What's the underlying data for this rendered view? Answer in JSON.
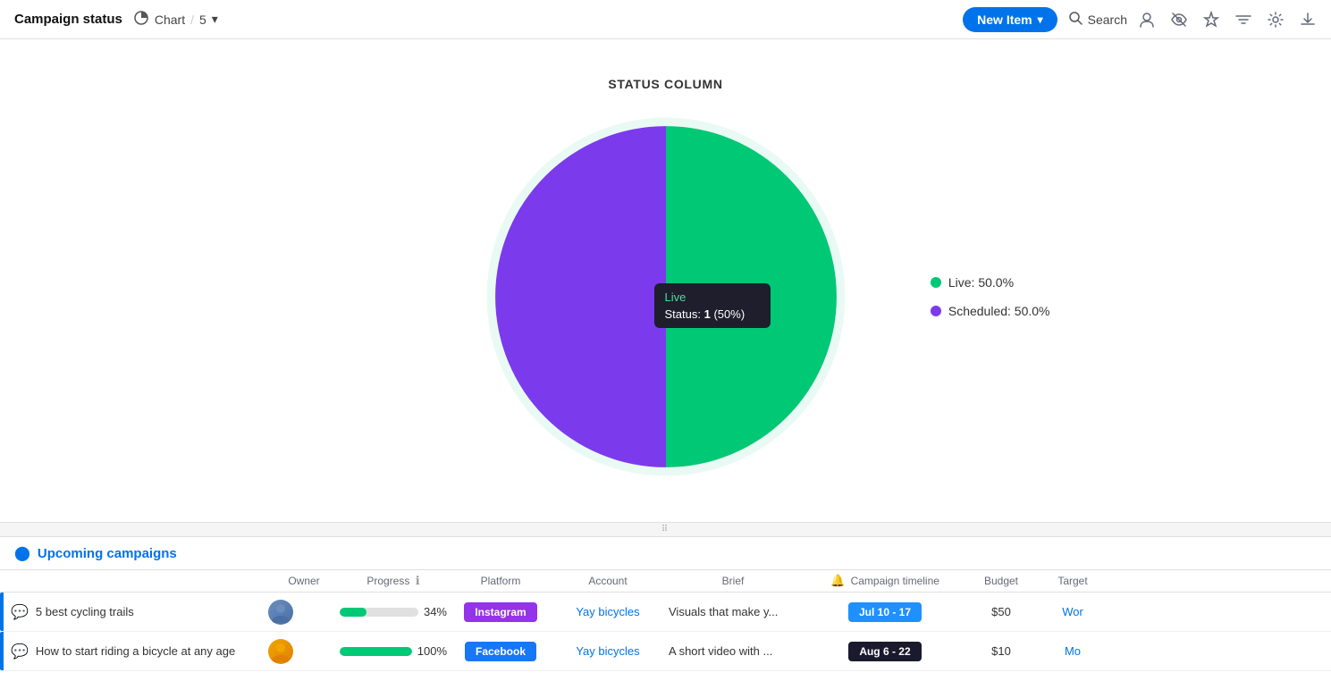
{
  "header": {
    "title": "Campaign status",
    "view_label": "Chart",
    "view_count": "5",
    "new_item_label": "New Item",
    "search_label": "Search"
  },
  "chart": {
    "title": "STATUS COLUMN",
    "legend": [
      {
        "label": "Live: 50.0%",
        "color": "#00c875"
      },
      {
        "label": "Scheduled: 50.0%",
        "color": "#7c3aed"
      }
    ],
    "tooltip": {
      "segment_label": "Live",
      "value_label": "Status:",
      "value": "1",
      "percent": "50%"
    },
    "segments": [
      {
        "label": "Live",
        "percent": 50,
        "color": "#00c875"
      },
      {
        "label": "Scheduled",
        "percent": 50,
        "color": "#7c3aed"
      }
    ]
  },
  "table": {
    "section_title": "Upcoming campaigns",
    "columns": [
      "Owner",
      "Progress",
      "Platform",
      "Account",
      "Brief",
      "Campaign timeline",
      "Budget",
      "Target"
    ],
    "rows": [
      {
        "name": "5 best cycling trails",
        "progress": 34,
        "progress_label": "34%",
        "platform": "Instagram",
        "platform_class": "instagram",
        "account": "Yay bicycles",
        "brief": "Visuals that make y...",
        "timeline": "Jul 10 - 17",
        "timeline_class": "timeline-blue",
        "budget": "$50",
        "target": "Wor"
      },
      {
        "name": "How to start riding a bicycle at any age",
        "progress": 100,
        "progress_label": "100%",
        "platform": "Facebook",
        "platform_class": "facebook",
        "account": "Yay bicycles",
        "brief": "A short video with ...",
        "timeline": "Aug 6 - 22",
        "timeline_class": "timeline-dark",
        "budget": "$10",
        "target": "Mo"
      }
    ]
  }
}
